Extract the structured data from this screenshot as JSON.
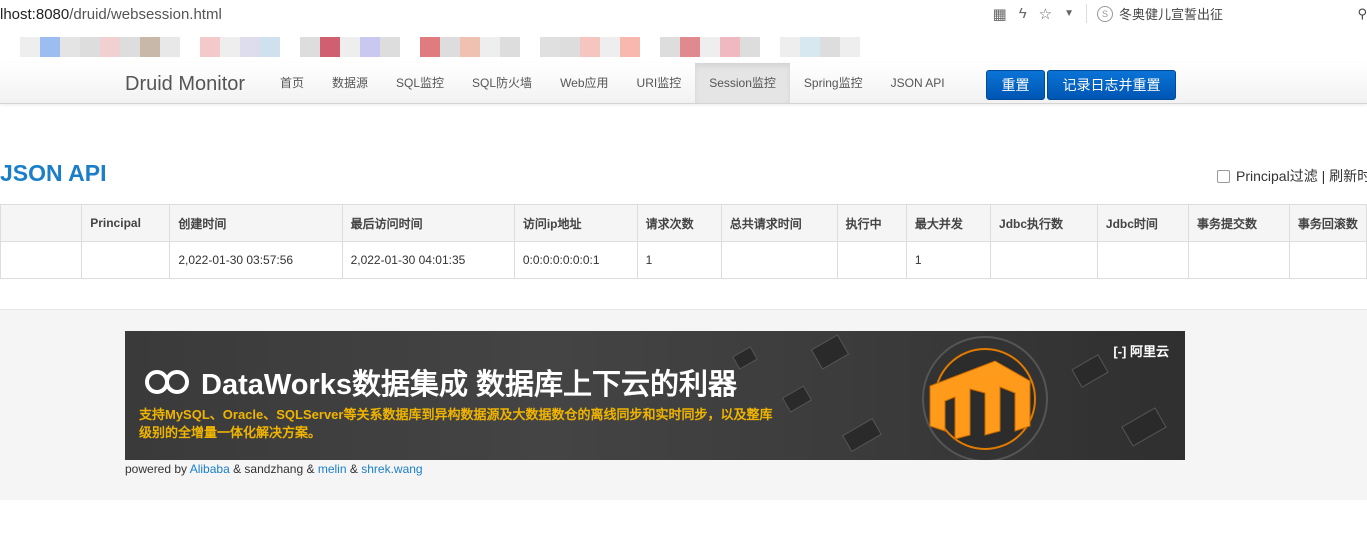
{
  "browser": {
    "url_host": "lhost:8080",
    "url_path": "/druid/websession.html",
    "search_text": "冬奥健儿宣誓出征"
  },
  "navbar": {
    "brand": "Druid Monitor",
    "items": [
      {
        "label": "首页"
      },
      {
        "label": "数据源"
      },
      {
        "label": "SQL监控"
      },
      {
        "label": "SQL防火墙"
      },
      {
        "label": "Web应用"
      },
      {
        "label": "URI监控"
      },
      {
        "label": "Session监控"
      },
      {
        "label": "Spring监控"
      },
      {
        "label": "JSON API"
      }
    ],
    "reset_label": "重置",
    "log_reset_label": "记录日志并重置"
  },
  "page": {
    "title": "JSON API",
    "filter_label": "Principal过滤 | 刷新时"
  },
  "table": {
    "headers": [
      "",
      "Principal",
      "创建时间",
      "最后访问时间",
      "访问ip地址",
      "请求次数",
      "总共请求时间",
      "执行中",
      "最大并发",
      "Jdbc执行数",
      "Jdbc时间",
      "事务提交数",
      "事务回滚数"
    ],
    "rows": [
      [
        "",
        "",
        "2,022-01-30 03:57:56",
        "2,022-01-30 04:01:35",
        "0:0:0:0:0:0:0:1",
        "1",
        "",
        "",
        "1",
        "",
        "",
        "",
        ""
      ]
    ]
  },
  "banner": {
    "title": "DataWorks数据集成 数据库上下云的利器",
    "subtitle": "支持MySQL、Oracle、SQLServer等关系数据库到异构数据源及大数据数仓的离线同步和实时同步，以及整库级别的全增量一体化解决方案。",
    "brand": "阿里云"
  },
  "footer": {
    "powered_by": "powered by",
    "alibaba": "Alibaba",
    "amp1": "& sandzhang &",
    "melin": "melin",
    "amp2": "&",
    "shrek": "shrek.wang"
  },
  "colors": {
    "accent": "#1a7ec9",
    "button": "#0a64c6",
    "banner_text": "#f0b400"
  }
}
